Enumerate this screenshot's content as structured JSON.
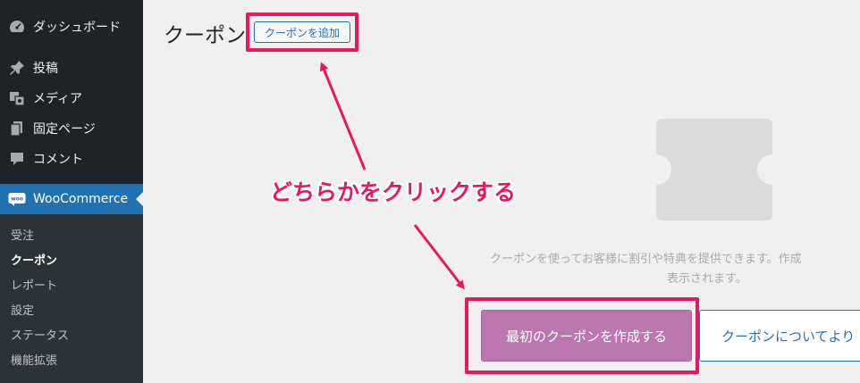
{
  "sidebar": {
    "items": [
      {
        "label": "ダッシュボード",
        "icon": "dashboard-icon"
      },
      {
        "label": "投稿",
        "icon": "pin-icon"
      },
      {
        "label": "メディア",
        "icon": "media-icon"
      },
      {
        "label": "固定ページ",
        "icon": "pages-icon"
      },
      {
        "label": "コメント",
        "icon": "comment-icon"
      },
      {
        "label": "WooCommerce",
        "icon": "woo-icon"
      }
    ],
    "submenu": [
      "受注",
      "クーポン",
      "レポート",
      "設定",
      "ステータス",
      "機能拡張"
    ]
  },
  "main": {
    "title": "クーポン",
    "add_button": "クーポンを追加",
    "empty_message_line1": "クーポンを使ってお客様に割引や特典を提供できます。作成",
    "empty_message_line2": "表示されます。",
    "create_button": "最初のクーポンを作成する",
    "about_button": "クーポンについてより"
  },
  "annotation": {
    "text": "どちらかをクリックする"
  },
  "colors": {
    "sidebar_bg": "#1d2327",
    "active_blue": "#2271b1",
    "woo_purple": "#bb77ae",
    "highlight_pink": "#e6195e"
  }
}
